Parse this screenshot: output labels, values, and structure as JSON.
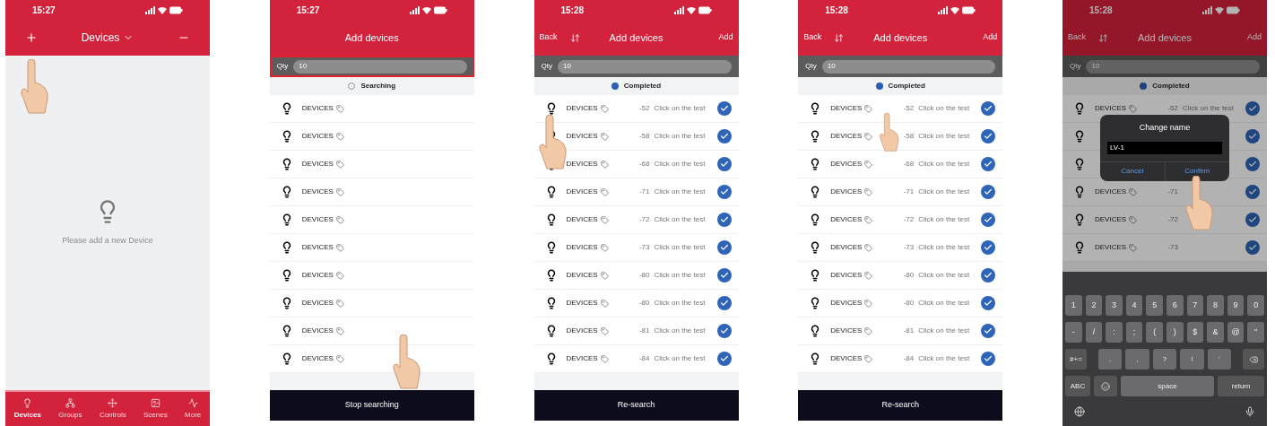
{
  "screens": [
    {
      "kind": "home",
      "time": "15:27",
      "title": "Devices",
      "empty_message": "Please add a new Device",
      "tabs": [
        {
          "label": "Devices",
          "selected": true
        },
        {
          "label": "Groups",
          "selected": false
        },
        {
          "label": "Controls",
          "selected": false
        },
        {
          "label": "Scenes",
          "selected": false
        },
        {
          "label": "More",
          "selected": false
        }
      ]
    },
    {
      "kind": "add",
      "time": "15:27",
      "title": "Add devices",
      "qty_label": "Qty",
      "qty_value": "10",
      "qty_highlighted": true,
      "search_state": {
        "kind": "searching",
        "label": "Searching"
      },
      "bottom_button": "Stop searching",
      "rows": [
        {
          "name": "DEVICES"
        },
        {
          "name": "DEVICES"
        },
        {
          "name": "DEVICES"
        },
        {
          "name": "DEVICES"
        },
        {
          "name": "DEVICES"
        },
        {
          "name": "DEVICES"
        },
        {
          "name": "DEVICES"
        },
        {
          "name": "DEVICES"
        },
        {
          "name": "DEVICES"
        },
        {
          "name": "DEVICES"
        }
      ]
    },
    {
      "kind": "add",
      "time": "15:28",
      "back": "Back",
      "title": "Add devices",
      "add": "Add",
      "qty_label": "Qty",
      "qty_value": "10",
      "qty_highlighted": false,
      "search_state": {
        "kind": "completed",
        "label": "Completed"
      },
      "bottom_button": "Re-search",
      "rows": [
        {
          "name": "DEVICES",
          "rssi": "-52",
          "hint": "Click on the test",
          "checked": true
        },
        {
          "name": "DEVICES",
          "rssi": "-58",
          "hint": "Click on the test",
          "checked": true
        },
        {
          "name": "DEVICES",
          "rssi": "-68",
          "hint": "Click on the test",
          "checked": true
        },
        {
          "name": "DEVICES",
          "rssi": "-71",
          "hint": "Click on the test",
          "checked": true
        },
        {
          "name": "DEVICES",
          "rssi": "-72",
          "hint": "Click on the test",
          "checked": true
        },
        {
          "name": "DEVICES",
          "rssi": "-73",
          "hint": "Click on the test",
          "checked": true
        },
        {
          "name": "DEVICES",
          "rssi": "-80",
          "hint": "Click on the test",
          "checked": true
        },
        {
          "name": "DEVICES",
          "rssi": "-80",
          "hint": "Click on the test",
          "checked": true
        },
        {
          "name": "DEVICES",
          "rssi": "-81",
          "hint": "Click on the test",
          "checked": true
        },
        {
          "name": "DEVICES",
          "rssi": "-84",
          "hint": "Click on the test",
          "checked": true
        }
      ]
    },
    {
      "kind": "add",
      "time": "15:28",
      "back": "Back",
      "title": "Add devices",
      "add": "Add",
      "qty_label": "Qty",
      "qty_value": "10",
      "qty_highlighted": false,
      "search_state": {
        "kind": "completed",
        "label": "Completed"
      },
      "bottom_button": "Re-search",
      "rows": [
        {
          "name": "DEVICES",
          "rssi": "-52",
          "hint": "Click on the test",
          "checked": true
        },
        {
          "name": "DEVICES",
          "rssi": "-58",
          "hint": "Click on the test",
          "checked": true
        },
        {
          "name": "DEVICES",
          "rssi": "-68",
          "hint": "Click on the test",
          "checked": true
        },
        {
          "name": "DEVICES",
          "rssi": "-71",
          "hint": "Click on the test",
          "checked": true
        },
        {
          "name": "DEVICES",
          "rssi": "-72",
          "hint": "Click on the test",
          "checked": true
        },
        {
          "name": "DEVICES",
          "rssi": "-73",
          "hint": "Click on the test",
          "checked": true
        },
        {
          "name": "DEVICES",
          "rssi": "-80",
          "hint": "Click on the test",
          "checked": true
        },
        {
          "name": "DEVICES",
          "rssi": "-80",
          "hint": "Click on the test",
          "checked": true
        },
        {
          "name": "DEVICES",
          "rssi": "-81",
          "hint": "Click on the test",
          "checked": true
        },
        {
          "name": "DEVICES",
          "rssi": "-84",
          "hint": "Click on the test",
          "checked": true
        }
      ]
    },
    {
      "kind": "add",
      "time": "15:28",
      "back": "Back",
      "title": "Add devices",
      "add": "Add",
      "qty_label": "Qty",
      "qty_value": "10",
      "qty_highlighted": false,
      "search_state": {
        "kind": "completed",
        "label": "Completed"
      },
      "dimmed": true,
      "rows": [
        {
          "name": "DEVICES",
          "rssi": "-52",
          "hint": "Click on the test",
          "checked": true
        },
        {
          "checked": true
        },
        {
          "checked": true
        },
        {
          "name": "DEVICES",
          "rssi": "-71",
          "checked": true
        },
        {
          "name": "DEVICES",
          "rssi": "-72",
          "checked": true
        },
        {
          "name": "DEVICES",
          "rssi": "-73",
          "checked": true
        }
      ],
      "dialog": {
        "title": "Change name",
        "value": "LV-1",
        "cancel": "Cancel",
        "confirm": "Confirm"
      },
      "keyboard": {
        "key_rows": [
          {
            "keys": [
              "1",
              "2",
              "3",
              "4",
              "5",
              "6",
              "7",
              "8",
              "9",
              "0"
            ]
          },
          {
            "keys": [
              "-",
              "/",
              ":",
              ";",
              "(",
              ")",
              "$",
              "&",
              "@",
              "\""
            ]
          },
          {
            "keys": [
              "#+=",
              ".",
              ",",
              "?",
              "!",
              "'"
            ]
          },
          {
            "keys": [
              "ABC",
              "space",
              "return"
            ]
          }
        ]
      }
    }
  ]
}
